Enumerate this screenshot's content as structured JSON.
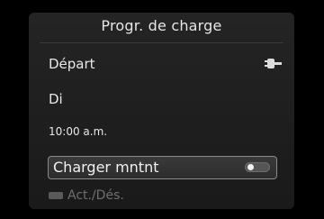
{
  "screen": {
    "title": "Progr. de charge",
    "departure_label": "Départ",
    "departure_icon": "plug-icon",
    "day": "Di",
    "time": "10:00 a.m.",
    "charge_now_label": "Charger mntnt",
    "charge_now_state": "off",
    "onoff_label": "Act./Dés.",
    "onoff_icon": "on-off-button-icon"
  }
}
